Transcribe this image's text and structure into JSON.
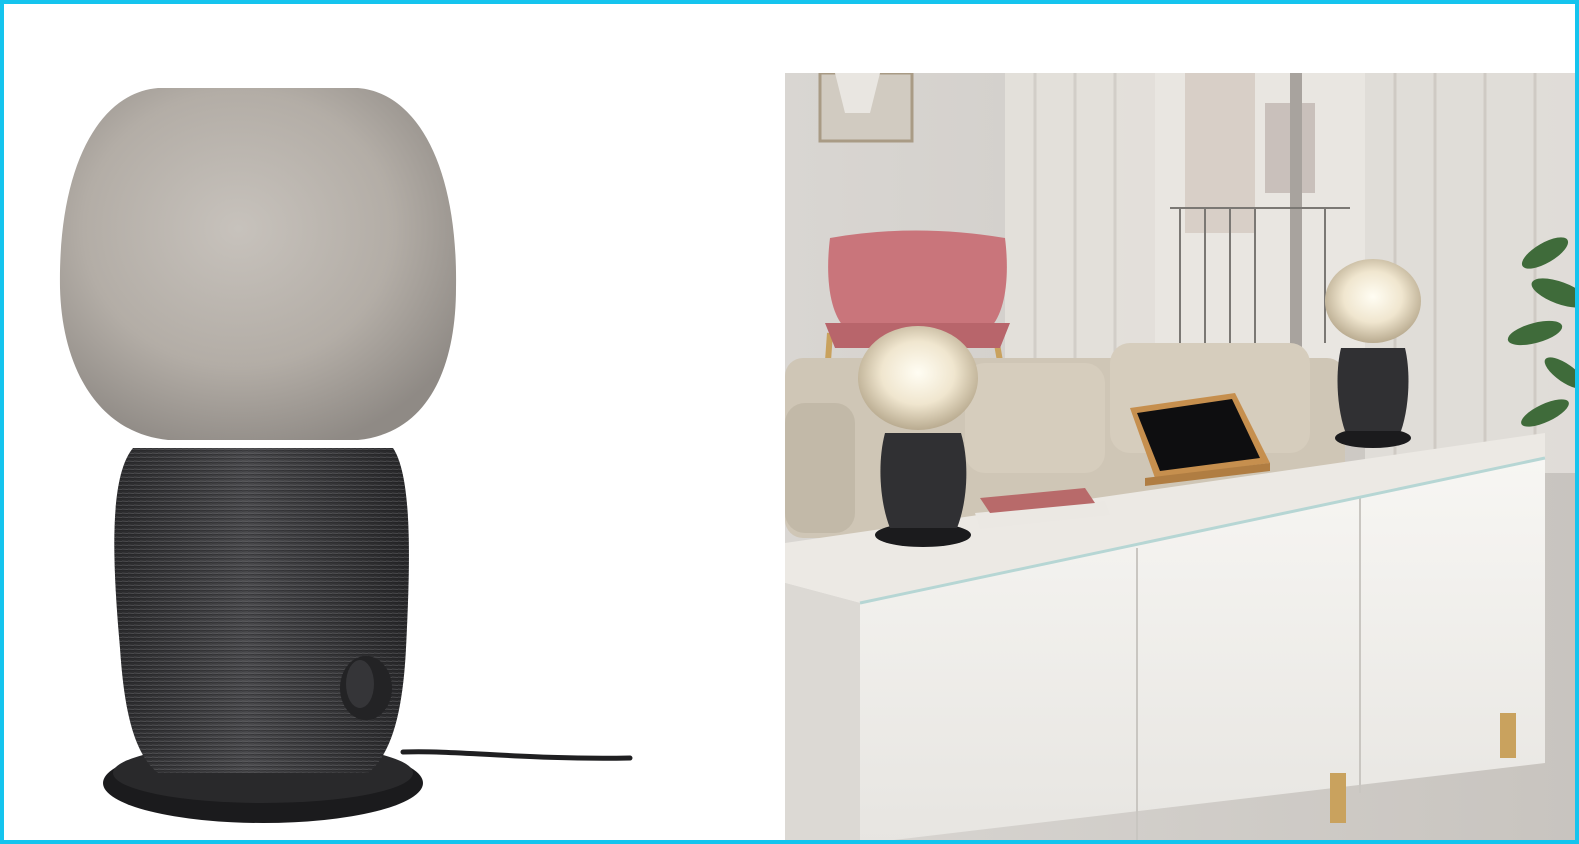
{
  "images": [
    {
      "id": "product-photo",
      "subject": "lamp-speaker",
      "shade_color": "#bdb7b0",
      "body_color": "#3a3a3c",
      "base_color": "#1b1b1d"
    },
    {
      "id": "room-photo",
      "subject": "living-room",
      "lamp_count": 2,
      "cabinet_color": "#f2f1ee",
      "chair_color": "#c9757b",
      "sofa_color": "#cfc6b6"
    }
  ],
  "colors": {
    "frame_border": "#15c4ee",
    "background": "#ffffff"
  }
}
